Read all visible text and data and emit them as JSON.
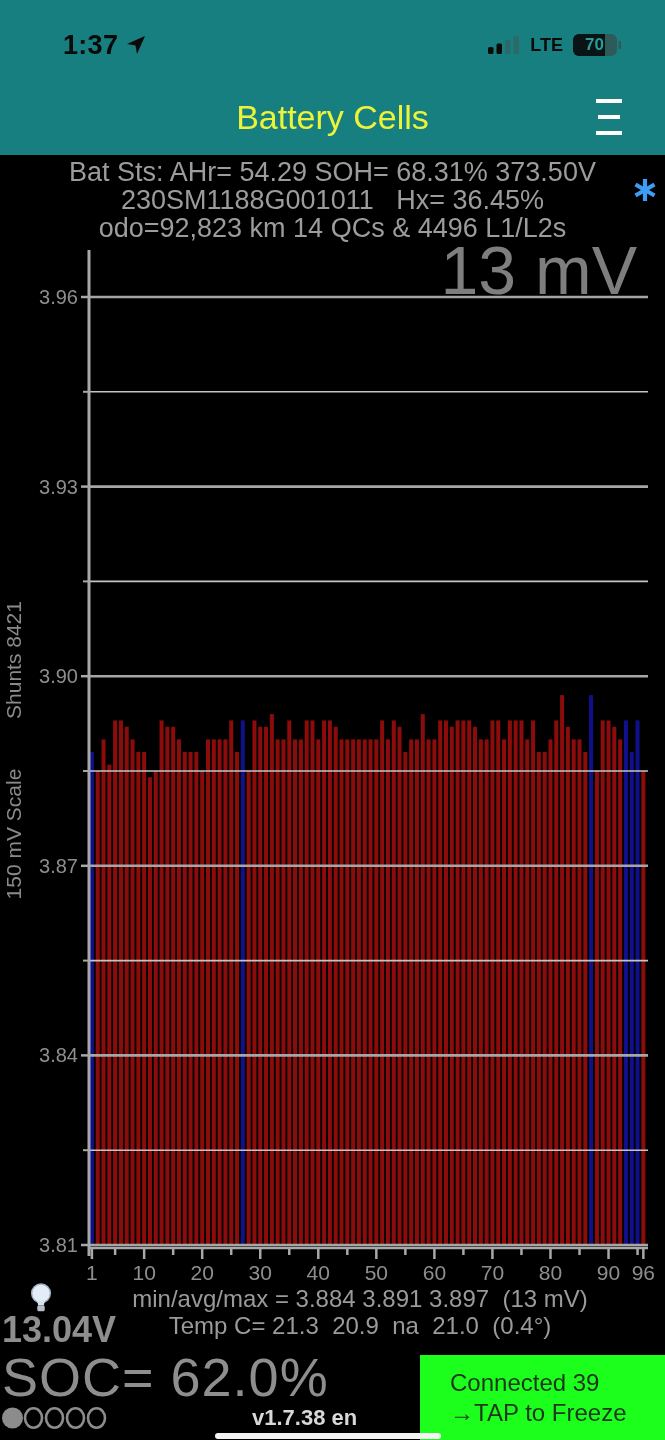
{
  "status_bar": {
    "time": "1:37",
    "network": "LTE",
    "battery": "70"
  },
  "header": {
    "title": "Battery Cells"
  },
  "battery_status": {
    "lines": [
      "Bat Sts: AHr= 54.29 SOH= 68.31% 373.50V",
      "230SM1188G001011   Hx= 36.45%",
      "odo=92,823 km 14 QCs & 4496 L1/L2s"
    ]
  },
  "chart": {
    "spread": "13 mV",
    "shunts": "Shunts 8421",
    "chart_data": {
      "type": "bar",
      "ylabel": "150 mV Scale",
      "grid": true,
      "x": [
        1,
        2,
        3,
        4,
        5,
        6,
        7,
        8,
        9,
        10,
        11,
        12,
        13,
        14,
        15,
        16,
        17,
        18,
        19,
        20,
        21,
        22,
        23,
        24,
        25,
        26,
        27,
        28,
        29,
        30,
        31,
        32,
        33,
        34,
        35,
        36,
        37,
        38,
        39,
        40,
        41,
        42,
        43,
        44,
        45,
        46,
        47,
        48,
        49,
        50,
        51,
        52,
        53,
        54,
        55,
        56,
        57,
        58,
        59,
        60,
        61,
        62,
        63,
        64,
        65,
        66,
        67,
        68,
        69,
        70,
        71,
        72,
        73,
        74,
        75,
        76,
        77,
        78,
        79,
        80,
        81,
        82,
        83,
        84,
        85,
        86,
        87,
        88,
        89,
        90,
        91,
        92,
        93,
        94,
        95,
        96
      ],
      "xlim": [
        0.5,
        96.8
      ],
      "xticks": [
        1,
        10,
        20,
        30,
        40,
        50,
        60,
        70,
        80,
        90,
        96
      ],
      "ylim": [
        3.81,
        3.96
      ],
      "yticks": [
        3.81,
        3.84,
        3.87,
        {
          "value": 3.9,
          "label": "3.90"
        },
        3.93,
        3.96
      ],
      "series": [
        {
          "color": "#8c0c0c",
          "values": [
            null,
            3.885,
            3.89,
            3.886,
            3.893,
            3.893,
            3.892,
            3.89,
            3.888,
            3.888,
            3.884,
            3.885,
            3.893,
            3.892,
            3.892,
            3.89,
            3.888,
            3.888,
            3.888,
            3.885,
            3.89,
            3.89,
            3.89,
            3.89,
            3.893,
            3.888,
            null,
            3.885,
            3.893,
            3.892,
            3.892,
            3.894,
            3.89,
            3.89,
            3.893,
            3.89,
            3.89,
            3.893,
            3.893,
            3.89,
            3.893,
            3.893,
            3.892,
            3.89,
            3.89,
            3.89,
            3.89,
            3.89,
            3.89,
            3.89,
            3.893,
            3.89,
            3.893,
            3.892,
            3.888,
            3.89,
            3.89,
            3.894,
            3.89,
            3.89,
            3.893,
            3.893,
            3.892,
            3.893,
            3.893,
            3.893,
            3.892,
            3.89,
            3.89,
            3.893,
            3.893,
            3.89,
            3.893,
            3.893,
            3.893,
            3.89,
            3.893,
            3.888,
            3.888,
            3.89,
            3.893,
            3.897,
            3.892,
            3.89,
            3.89,
            3.888,
            null,
            3.885,
            3.893,
            3.893,
            3.892,
            3.89,
            null,
            null,
            null,
            3.885
          ]
        },
        {
          "color": "#10108c",
          "values": [
            3.888,
            null,
            null,
            null,
            null,
            null,
            null,
            null,
            null,
            null,
            null,
            null,
            null,
            null,
            null,
            null,
            null,
            null,
            null,
            null,
            null,
            null,
            null,
            null,
            null,
            null,
            3.893,
            null,
            null,
            null,
            null,
            null,
            null,
            null,
            null,
            null,
            null,
            null,
            null,
            null,
            null,
            null,
            null,
            null,
            null,
            null,
            null,
            null,
            null,
            null,
            null,
            null,
            null,
            null,
            null,
            null,
            null,
            null,
            null,
            null,
            null,
            null,
            null,
            null,
            null,
            null,
            null,
            null,
            null,
            null,
            null,
            null,
            null,
            null,
            null,
            null,
            null,
            null,
            null,
            null,
            null,
            null,
            null,
            null,
            null,
            null,
            3.897,
            null,
            null,
            null,
            null,
            null,
            3.893,
            3.888,
            3.893,
            null
          ]
        }
      ]
    }
  },
  "summary": {
    "min_avg_max": "min/avg/max = 3.884 3.891 3.897  (13 mV)",
    "temperature": "Temp C= 21.3  20.9  na  21.0  (0.4°)",
    "aux_voltage": "13.04V",
    "soc": "SOC= 62.0%",
    "dots": [
      {
        "filled": true
      },
      {
        "filled": false
      },
      {
        "filled": false
      },
      {
        "filled": false
      },
      {
        "filled": false
      }
    ],
    "version": "v1.7.38 en"
  },
  "freeze_button": {
    "lines": [
      "Connected 39",
      "→TAP to Freeze"
    ]
  }
}
